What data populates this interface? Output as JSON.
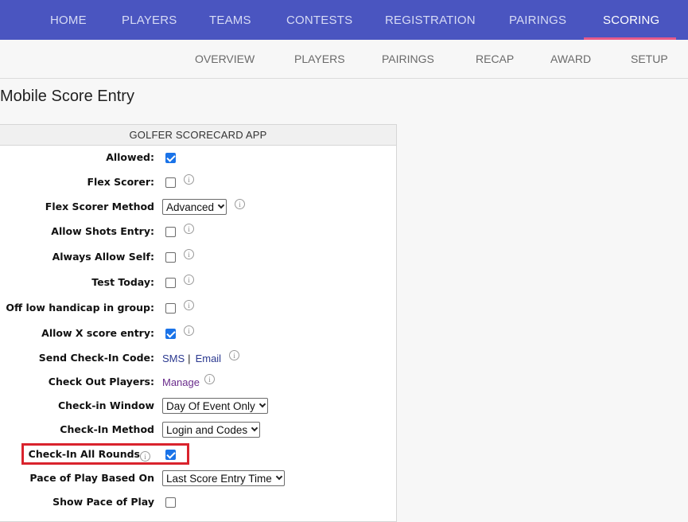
{
  "top_nav": {
    "items": [
      "HOME",
      "PLAYERS",
      "TEAMS",
      "CONTESTS",
      "REGISTRATION",
      "PAIRINGS",
      "SCORING"
    ],
    "active": "SCORING",
    "bg_color": "#4a55c0",
    "underline_color": "#e75a8a"
  },
  "sub_nav": {
    "items": [
      "OVERVIEW",
      "PLAYERS",
      "PAIRINGS",
      "RECAP",
      "AWARD",
      "SETUP"
    ]
  },
  "page_title": "Mobile Score Entry",
  "panel": {
    "header": "GOLFER SCORECARD APP",
    "rows": [
      {
        "label": "Allowed:",
        "checked": true
      },
      {
        "label": "Flex Scorer:",
        "checked": false,
        "info_icon": "info-icon"
      },
      {
        "label": "Flex Scorer Method",
        "select_value": "Advanced",
        "info_icon": "info-icon"
      },
      {
        "label": "Allow Shots Entry:",
        "checked": false,
        "info_icon": "info-icon"
      },
      {
        "label": "Always Allow Self:",
        "checked": false,
        "info_icon": "info-icon"
      },
      {
        "label": "Test Today:",
        "checked": false,
        "info_icon": "info-icon"
      },
      {
        "label": "Off low handicap in group:",
        "checked": false,
        "info_icon": "info-icon"
      },
      {
        "label": "Allow X score entry:",
        "checked": true,
        "info_icon": "info-icon"
      },
      {
        "label": "Send Check-In Code:",
        "link_sms": "SMS",
        "link_sep": "|",
        "link_email": "Email",
        "info_icon": "info-icon"
      },
      {
        "label": "Check Out Players:",
        "link_manage": "Manage",
        "info_icon": "info-icon"
      },
      {
        "label": "Check-in Window",
        "select_value": "Day Of Event Only"
      },
      {
        "label": "Check-In Method",
        "select_value": "Login and Codes"
      },
      {
        "label": "Check-In All Rounds",
        "checked": true,
        "info_icon": "info-icon"
      },
      {
        "label": "Pace of Play Based On",
        "select_value": "Last Score Entry Time"
      },
      {
        "label": "Show Pace of Play",
        "checked": false
      }
    ]
  },
  "highlight_color": "#d9232d",
  "checkbox_on_color": "#1a73e8"
}
